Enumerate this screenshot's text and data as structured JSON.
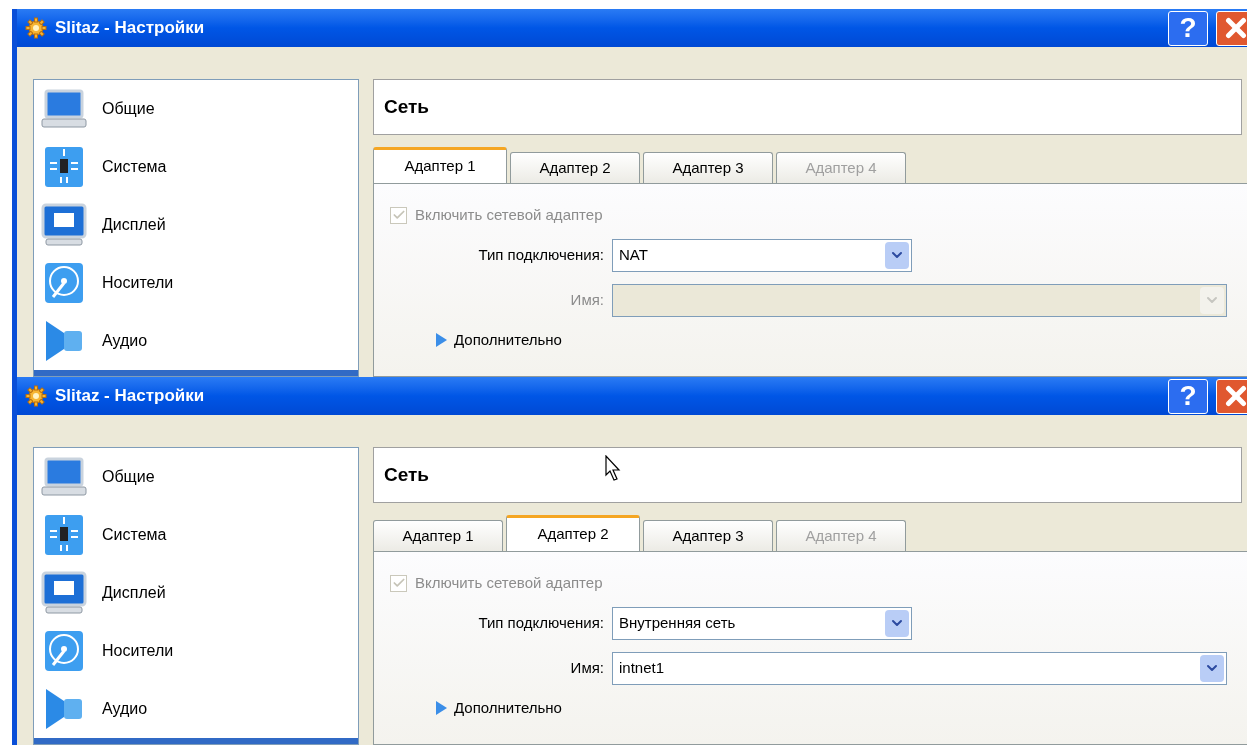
{
  "windows": [
    {
      "title": "Slitaz - Настройки",
      "help_button": "?",
      "sidebar": {
        "items": [
          {
            "label": "Общие",
            "selected": false
          },
          {
            "label": "Система",
            "selected": false
          },
          {
            "label": "Дисплей",
            "selected": false
          },
          {
            "label": "Носители",
            "selected": false
          },
          {
            "label": "Аудио",
            "selected": false
          },
          {
            "selected": true
          }
        ]
      },
      "section_title": "Сеть",
      "tabs": [
        {
          "label": "Адаптер 1",
          "selected": true,
          "disabled": false
        },
        {
          "label": "Адаптер 2",
          "selected": false,
          "disabled": false
        },
        {
          "label": "Адаптер 3",
          "selected": false,
          "disabled": false
        },
        {
          "label": "Адаптер 4",
          "selected": false,
          "disabled": true
        }
      ],
      "enable_checkbox": {
        "label": "Включить сетевой адаптер",
        "checked": true,
        "disabled": true
      },
      "connection_type": {
        "label": "Тип подключения:",
        "value": "NAT",
        "disabled": false
      },
      "name": {
        "label": "Имя:",
        "disabled": true
      },
      "advanced": {
        "label": "Дополнительно",
        "expanded": false
      },
      "cursor": false
    },
    {
      "title": "Slitaz - Настройки",
      "help_button": "?",
      "sidebar": {
        "items": [
          {
            "label": "Общие",
            "selected": false
          },
          {
            "label": "Система",
            "selected": false
          },
          {
            "label": "Дисплей",
            "selected": false
          },
          {
            "label": "Носители",
            "selected": false
          },
          {
            "label": "Аудио",
            "selected": false
          },
          {
            "selected": true
          }
        ]
      },
      "section_title": "Сеть",
      "tabs": [
        {
          "label": "Адаптер 1",
          "selected": false,
          "disabled": false
        },
        {
          "label": "Адаптер 2",
          "selected": true,
          "disabled": false
        },
        {
          "label": "Адаптер 3",
          "selected": false,
          "disabled": false
        },
        {
          "label": "Адаптер 4",
          "selected": false,
          "disabled": true
        }
      ],
      "enable_checkbox": {
        "label": "Включить сетевой адаптер",
        "checked": true,
        "disabled": true
      },
      "connection_type": {
        "label": "Тип подключения:",
        "value": "Внутренняя сеть",
        "disabled": false
      },
      "name": {
        "label": "Имя:",
        "value": "intnet1",
        "disabled": false
      },
      "advanced": {
        "label": "Дополнительно",
        "expanded": false
      },
      "cursor": true
    }
  ]
}
